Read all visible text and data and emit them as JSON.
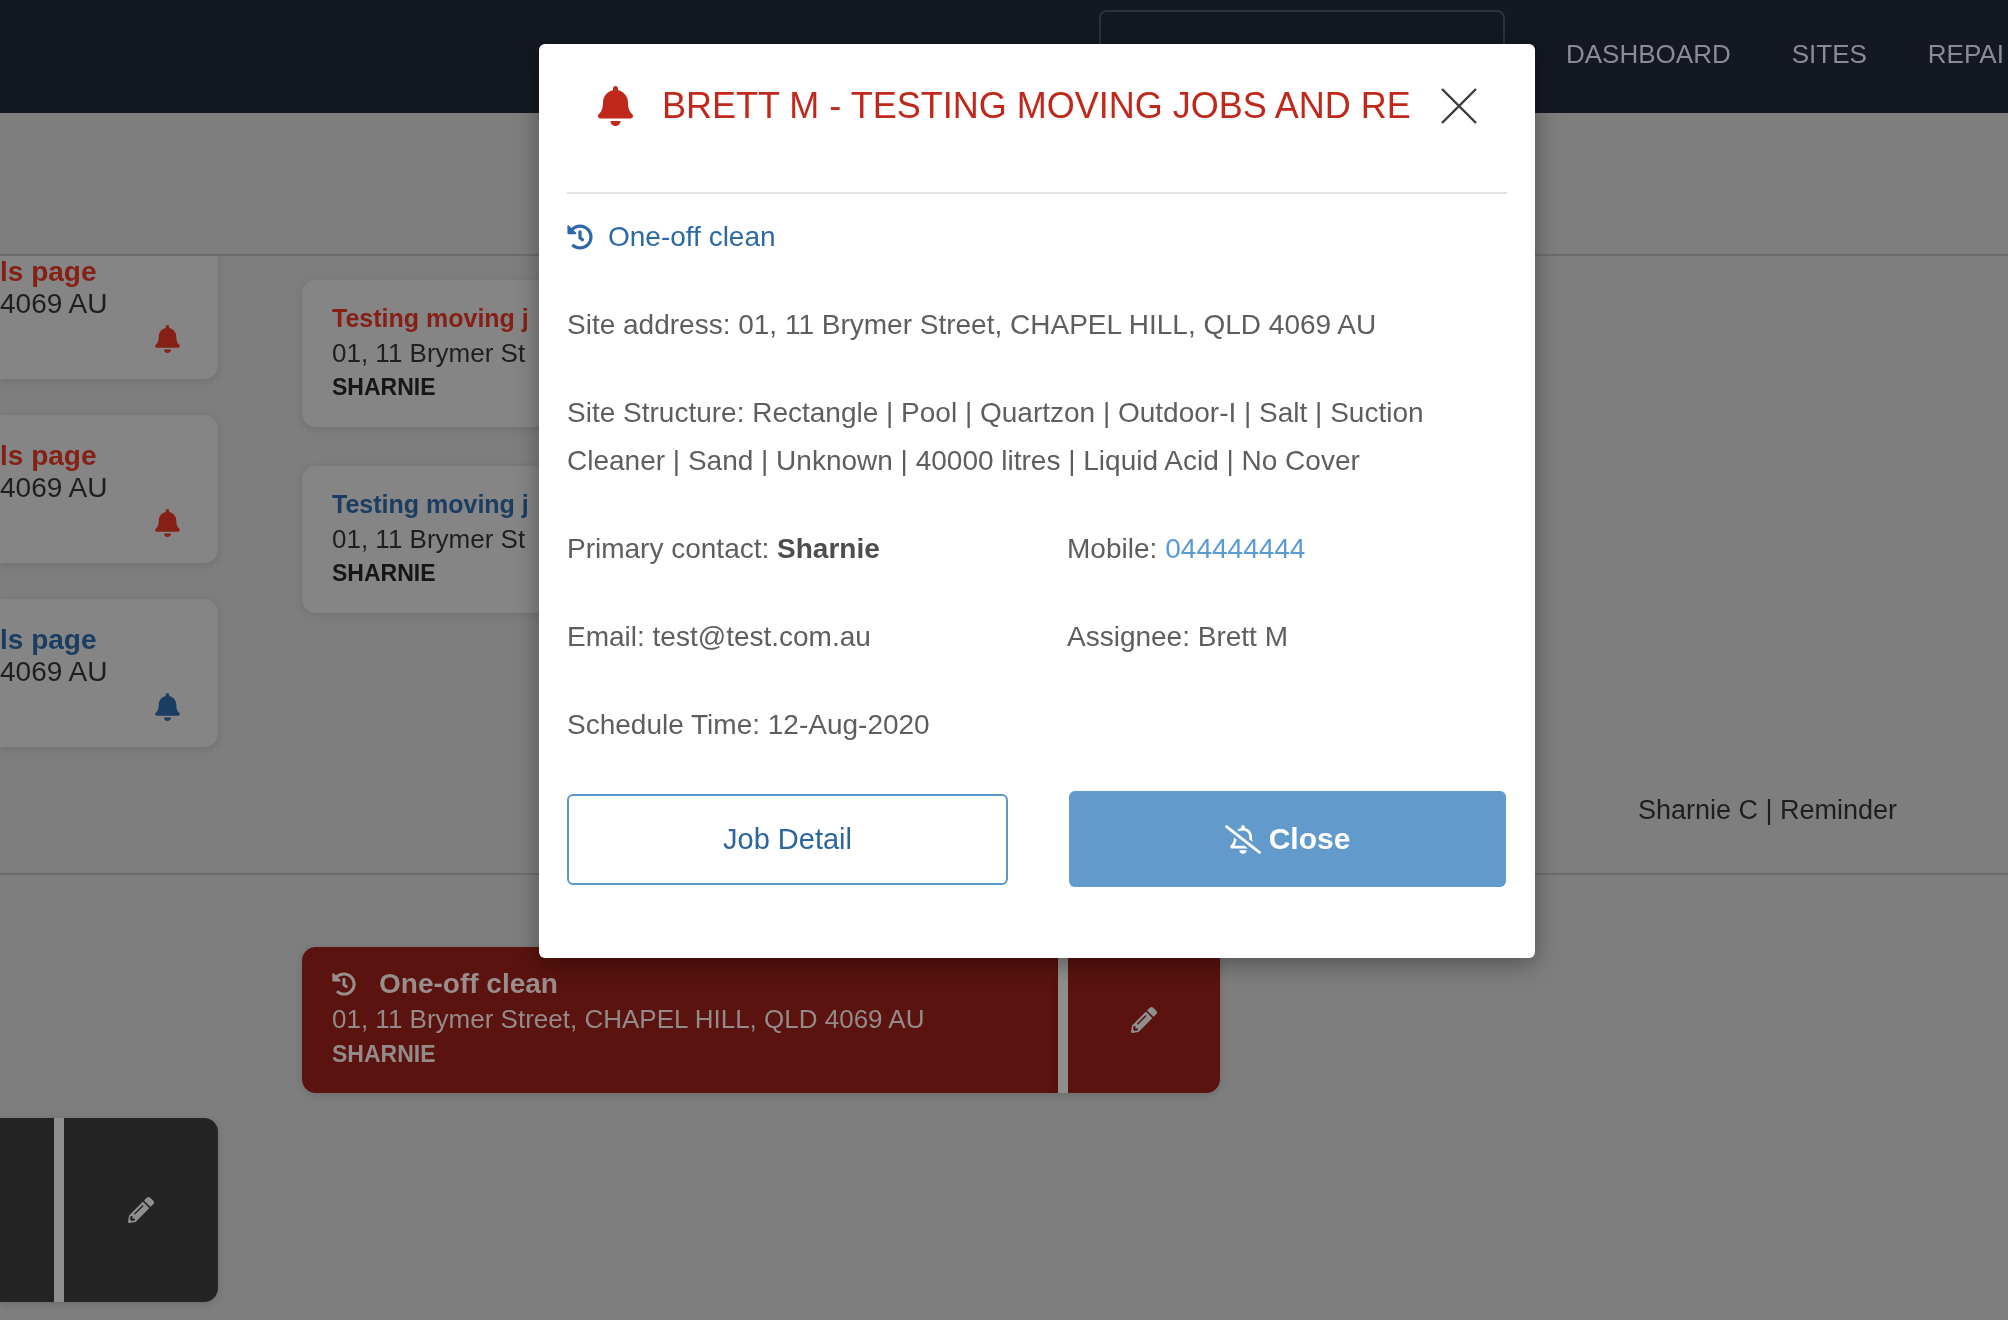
{
  "navbar": {
    "menu": [
      "DASHBOARD",
      "SITES",
      "REPAI"
    ]
  },
  "schedule": {
    "column_1": [
      {
        "title": "ls page",
        "address": "4069 AU",
        "color": "#861f14"
      },
      {
        "title": "ls page",
        "address": "4069 AU",
        "color": "#861f14"
      },
      {
        "title": "ls page",
        "address": "4069 AU",
        "color": "#1b3d61"
      }
    ],
    "column_2": [
      {
        "title": "Testing moving j",
        "address": "01, 11 Brymer St",
        "contact": "SHARNIE",
        "color": "#861f14"
      },
      {
        "title": "Testing moving j",
        "address": "01, 11 Brymer St",
        "contact": "SHARNIE",
        "color": "#1b3d61"
      }
    ],
    "reminder_label": "Sharnie C | Reminder",
    "lower_column_1": [
      {
        "color": "#242424"
      }
    ],
    "lower_column_2": [
      {
        "type": "One-off clean",
        "address": "01, 11 Brymer Street, CHAPEL HILL, QLD 4069 AU",
        "contact": "SHARNIE",
        "color": "#5a130e"
      }
    ]
  },
  "dialog": {
    "title": "BRETT M - TESTING MOVING JOBS AND RE",
    "job_type": "One-off clean",
    "site_address": "Site address: 01, 11 Brymer Street, CHAPEL HILL, QLD 4069 AU",
    "site_structure": "Site Structure: Rectangle | Pool | Quartzon | Outdoor-I | Salt | Suction Cleaner | Sand | Unknown | 40000 litres | Liquid Acid | No Cover",
    "details": [
      {
        "kind": "text",
        "text": "Primary contact: **Sharnie**"
      },
      {
        "kind": "phone",
        "label": "Mobile:",
        "link": "044444444"
      },
      {
        "kind": "text",
        "text": "Email: test@test.com.au"
      },
      {
        "kind": "text",
        "text": "Assignee: Brett M"
      },
      {
        "kind": "text",
        "text": "Schedule Time: 12-Aug-2020"
      }
    ],
    "buttons": [
      {
        "kind": "outline",
        "label": "Job Detail"
      },
      {
        "kind": "primary",
        "label": "Close"
      }
    ]
  }
}
